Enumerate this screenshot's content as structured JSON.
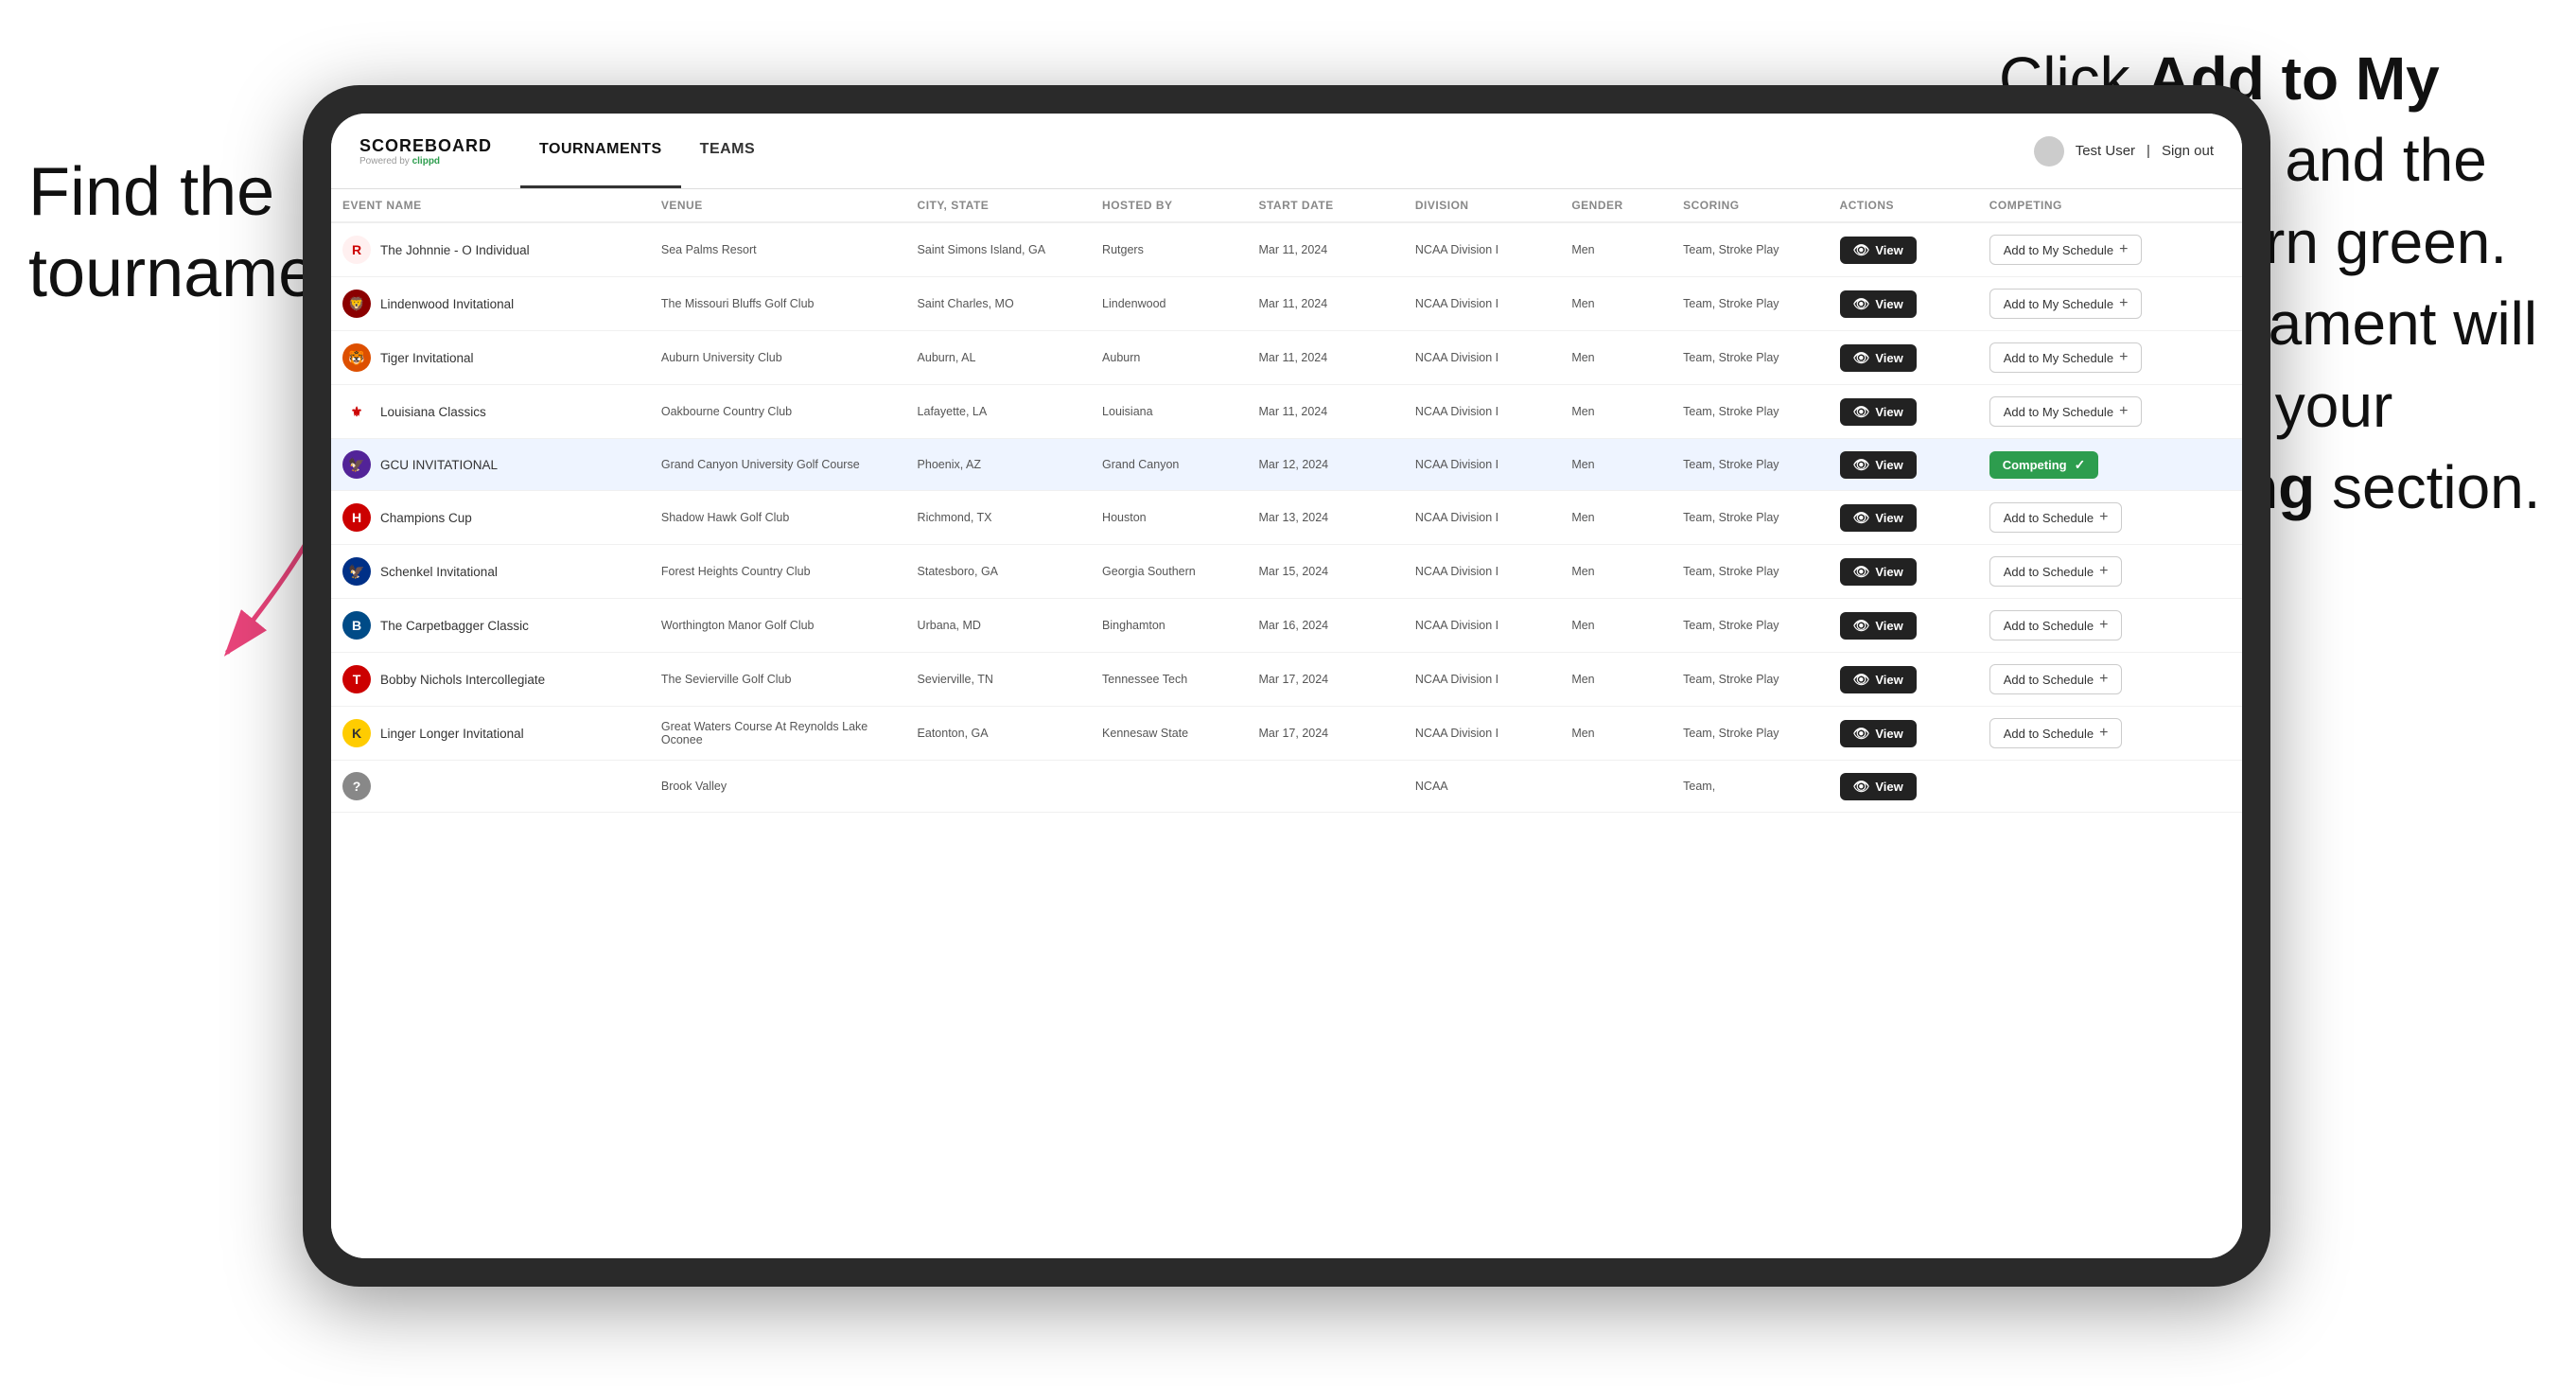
{
  "annotations": {
    "left": "Find the\ntournament.",
    "right_part1": "Click ",
    "right_bold1": "Add to My Schedule",
    "right_part2": " and the box will turn green. This tournament will now be in your ",
    "right_bold2": "Competing",
    "right_part3": " section."
  },
  "header": {
    "logo": "SCOREBOARD",
    "powered_by": "Powered by",
    "clippd": "clippd",
    "tabs": [
      "TOURNAMENTS",
      "TEAMS"
    ],
    "active_tab": "TOURNAMENTS",
    "user": "Test User",
    "sign_out": "Sign out"
  },
  "table": {
    "columns": [
      "EVENT NAME",
      "VENUE",
      "CITY, STATE",
      "HOSTED BY",
      "START DATE",
      "DIVISION",
      "GENDER",
      "SCORING",
      "ACTIONS",
      "COMPETING"
    ],
    "rows": [
      {
        "logo": "R",
        "logo_color": "#cc0000",
        "event": "The Johnnie - O Individual",
        "venue": "Sea Palms Resort",
        "city": "Saint Simons Island, GA",
        "hosted": "Rutgers",
        "date": "Mar 11, 2024",
        "division": "NCAA Division I",
        "gender": "Men",
        "scoring": "Team, Stroke Play",
        "action": "View",
        "competing": "Add to My Schedule",
        "status": "add"
      },
      {
        "logo": "LU",
        "logo_color": "#8B0000",
        "event": "Lindenwood Invitational",
        "venue": "The Missouri Bluffs Golf Club",
        "city": "Saint Charles, MO",
        "hosted": "Lindenwood",
        "date": "Mar 11, 2024",
        "division": "NCAA Division I",
        "gender": "Men",
        "scoring": "Team, Stroke Play",
        "action": "View",
        "competing": "Add to My Schedule",
        "status": "add"
      },
      {
        "logo": "AU",
        "logo_color": "#DD4F00",
        "event": "Tiger Invitational",
        "venue": "Auburn University Club",
        "city": "Auburn, AL",
        "hosted": "Auburn",
        "date": "Mar 11, 2024",
        "division": "NCAA Division I",
        "gender": "Men",
        "scoring": "Team, Stroke Play",
        "action": "View",
        "competing": "Add to My Schedule",
        "status": "add"
      },
      {
        "logo": "LA",
        "logo_color": "#8B0000",
        "event": "Louisiana Classics",
        "venue": "Oakbourne Country Club",
        "city": "Lafayette, LA",
        "hosted": "Louisiana",
        "date": "Mar 11, 2024",
        "division": "NCAA Division I",
        "gender": "Men",
        "scoring": "Team, Stroke Play",
        "action": "View",
        "competing": "Add to My Schedule",
        "status": "add"
      },
      {
        "logo": "GCU",
        "logo_color": "#522398",
        "event": "GCU INVITATIONAL",
        "venue": "Grand Canyon University Golf Course",
        "city": "Phoenix, AZ",
        "hosted": "Grand Canyon",
        "date": "Mar 12, 2024",
        "division": "NCAA Division I",
        "gender": "Men",
        "scoring": "Team, Stroke Play",
        "action": "View",
        "competing": "Competing",
        "status": "competing",
        "highlighted": true
      },
      {
        "logo": "HOU",
        "logo_color": "#cc0000",
        "event": "Champions Cup",
        "venue": "Shadow Hawk Golf Club",
        "city": "Richmond, TX",
        "hosted": "Houston",
        "date": "Mar 13, 2024",
        "division": "NCAA Division I",
        "gender": "Men",
        "scoring": "Team, Stroke Play",
        "action": "View",
        "competing": "Add to Schedule",
        "status": "add"
      },
      {
        "logo": "GS",
        "logo_color": "#003087",
        "event": "Schenkel Invitational",
        "venue": "Forest Heights Country Club",
        "city": "Statesboro, GA",
        "hosted": "Georgia Southern",
        "date": "Mar 15, 2024",
        "division": "NCAA Division I",
        "gender": "Men",
        "scoring": "Team, Stroke Play",
        "action": "View",
        "competing": "Add to Schedule",
        "status": "add"
      },
      {
        "logo": "BU",
        "logo_color": "#004B87",
        "event": "The Carpetbagger Classic",
        "venue": "Worthington Manor Golf Club",
        "city": "Urbana, MD",
        "hosted": "Binghamton",
        "date": "Mar 16, 2024",
        "division": "NCAA Division I",
        "gender": "Men",
        "scoring": "Team, Stroke Play",
        "action": "View",
        "competing": "Add to Schedule",
        "status": "add"
      },
      {
        "logo": "TT",
        "logo_color": "#CC0000",
        "event": "Bobby Nichols Intercollegiate",
        "venue": "The Sevierville Golf Club",
        "city": "Sevierville, TN",
        "hosted": "Tennessee Tech",
        "date": "Mar 17, 2024",
        "division": "NCAA Division I",
        "gender": "Men",
        "scoring": "Team, Stroke Play",
        "action": "View",
        "competing": "Add to Schedule",
        "status": "add"
      },
      {
        "logo": "KSU",
        "logo_color": "#FFCC00",
        "event": "Linger Longer Invitational",
        "venue": "Great Waters Course At Reynolds Lake Oconee",
        "city": "Eatonton, GA",
        "hosted": "Kennesaw State",
        "date": "Mar 17, 2024",
        "division": "NCAA Division I",
        "gender": "Men",
        "scoring": "Team, Stroke Play",
        "action": "View",
        "competing": "Add to Schedule",
        "status": "add"
      },
      {
        "logo": "?",
        "logo_color": "#888",
        "event": "",
        "venue": "Brook Valley",
        "city": "",
        "hosted": "",
        "date": "",
        "division": "NCAA",
        "gender": "",
        "scoring": "Team,",
        "action": "View",
        "competing": "",
        "status": "add"
      }
    ]
  },
  "colors": {
    "competing_green": "#2d9d4e",
    "dark_btn": "#222222",
    "arrow_pink": "#e8447a"
  }
}
